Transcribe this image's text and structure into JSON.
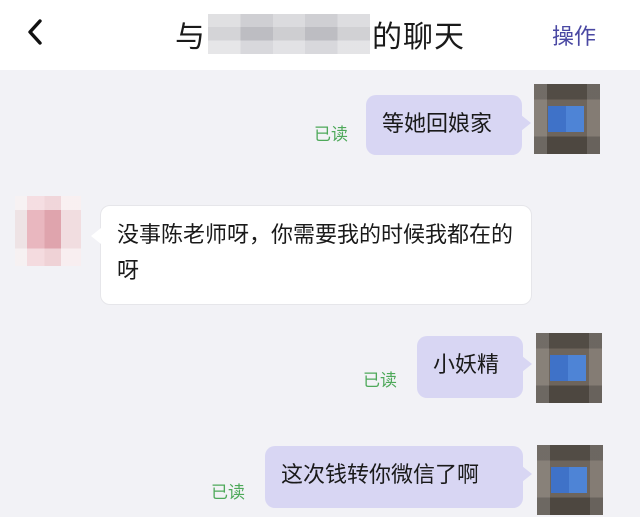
{
  "header": {
    "back_icon": "chevron-left-icon",
    "title_prefix": "与",
    "title_suffix": "的聊天",
    "action_label": "操作"
  },
  "colors": {
    "accent": "#4a48a3",
    "outgoing_bubble": "#d8d6f3",
    "read_status": "#4ea95a",
    "background": "#f2f2f6"
  },
  "messages": [
    {
      "direction": "out",
      "text": "等她回娘家",
      "status": "已读"
    },
    {
      "direction": "in",
      "text": "没事陈老师呀，你需要我的时候我都在的呀"
    },
    {
      "direction": "out",
      "text": "小妖精",
      "status": "已读"
    },
    {
      "direction": "out",
      "text": "这次钱转你微信了啊",
      "status": "已读"
    }
  ]
}
